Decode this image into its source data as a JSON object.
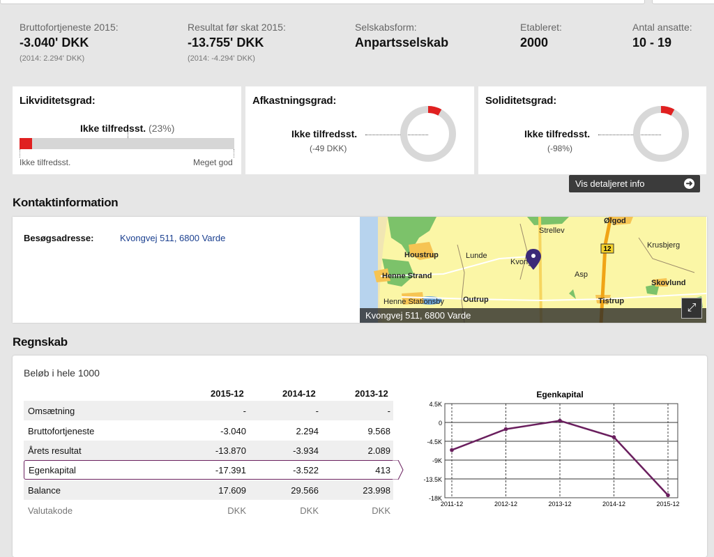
{
  "kpis": [
    {
      "label": "Bruttofortjeneste 2015:",
      "value": "-3.040' DKK",
      "sub": "(2014: 2.294' DKK)"
    },
    {
      "label": "Resultat før skat 2015:",
      "value": "-13.755' DKK",
      "sub": "(2014: -4.294' DKK)"
    },
    {
      "label": "Selskabsform:",
      "value": "Anpartsselskab",
      "sub": ""
    },
    {
      "label": "Etableret:",
      "value": "2000",
      "sub": ""
    },
    {
      "label": "Antal ansatte:",
      "value": "10 - 19",
      "sub": ""
    }
  ],
  "ratios": {
    "liquidity": {
      "title": "Likviditetsgrad:",
      "status": "Ikke tilfredsst.",
      "percent": "(23%)",
      "fill_fraction": 0.06,
      "low_label": "Ikke tilfredsst.",
      "high_label": "Meget god"
    },
    "return": {
      "title": "Afkastningsgrad:",
      "status": "Ikke tilfredsst.",
      "sub": "(-49 DKK)",
      "donut_fraction": 0.08
    },
    "solidity": {
      "title": "Soliditetsgrad:",
      "status": "Ikke tilfredsst.",
      "sub": "(-98%)",
      "donut_fraction": 0.08
    }
  },
  "detail_button": {
    "label": "Vis detaljeret info"
  },
  "contact": {
    "section_title": "Kontaktinformation",
    "address_label": "Besøgsadresse:",
    "address_value": "Kvongvej 511, 6800 Varde",
    "map_caption": "Kvongvej 511, 6800 Varde",
    "map_places": [
      "Strellev",
      "Ølgod",
      "Houstrup",
      "Lunde",
      "Kvong",
      "Krusbjerg",
      "Henne Strand",
      "Asp",
      "Skovlund",
      "Henne Stationsby",
      "Outrup",
      "Tistrup",
      "12"
    ]
  },
  "accounts": {
    "section_title": "Regnskab",
    "unit_note": "Beløb i hele 1000",
    "columns": [
      "2015-12",
      "2014-12",
      "2013-12"
    ],
    "rows": [
      {
        "label": "Omsætning",
        "values": [
          "-",
          "-",
          "-"
        ]
      },
      {
        "label": "Bruttofortjeneste",
        "values": [
          "-3.040",
          "2.294",
          "9.568"
        ]
      },
      {
        "label": "Årets resultat",
        "values": [
          "-13.870",
          "-3.934",
          "2.089"
        ]
      },
      {
        "label": "Egenkapital",
        "values": [
          "-17.391",
          "-3.522",
          "413"
        ]
      },
      {
        "label": "Balance",
        "values": [
          "17.609",
          "29.566",
          "23.998"
        ]
      },
      {
        "label": "Valutakode",
        "values": [
          "DKK",
          "DKK",
          "DKK"
        ]
      }
    ]
  },
  "chart_data": {
    "type": "line",
    "title": "Egenkapital",
    "x": [
      "2011-12",
      "2012-12",
      "2013-12",
      "2014-12",
      "2015-12"
    ],
    "series": [
      {
        "values": [
          -6600,
          -1600,
          413,
          -3522,
          -17391
        ]
      }
    ],
    "yticks": [
      "4.5K",
      "0",
      "-4.5K",
      "-9K",
      "-13.5K",
      "-18K"
    ],
    "ylim": [
      -18000,
      4500
    ],
    "line_color": "#6a1f5e"
  }
}
